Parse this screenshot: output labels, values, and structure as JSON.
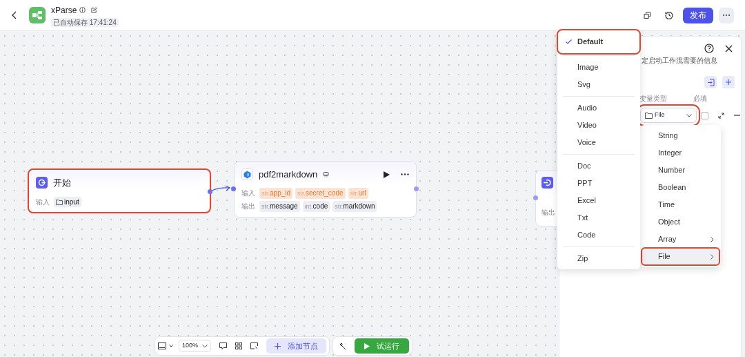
{
  "header": {
    "title": "xParse",
    "saved_badge": "已自动保存 17:41:24",
    "publish_button": "发布"
  },
  "nodes": [
    {
      "kind": "start",
      "title": "开始",
      "highlighted": true,
      "rows": [
        {
          "label": "输入",
          "tags": [
            {
              "kind": "folder",
              "name": "input"
            }
          ]
        }
      ]
    },
    {
      "kind": "plugin",
      "title": "pdf2markdown",
      "highlighted": false,
      "rows": [
        {
          "label": "输入",
          "tags": [
            {
              "kind": "input",
              "type": "str.",
              "name": "app_id"
            },
            {
              "kind": "input",
              "type": "str.",
              "name": "secret_code"
            },
            {
              "kind": "input",
              "type": "str.",
              "name": "url"
            }
          ]
        },
        {
          "label": "输出",
          "tags": [
            {
              "kind": "output",
              "type": "str.",
              "name": "message"
            },
            {
              "kind": "output",
              "type": "int.",
              "name": "code"
            },
            {
              "kind": "output",
              "type": "str.",
              "name": "markdown"
            }
          ]
        }
      ]
    },
    {
      "kind": "end",
      "highlighted": false,
      "rows": [
        {
          "label": "输出",
          "tags": []
        }
      ]
    }
  ],
  "panel": {
    "description": "定启动工作流需要的信息",
    "columns": [
      "变量类型",
      "必填"
    ],
    "variable": {
      "type": "File",
      "required": false,
      "highlighted": true
    }
  },
  "type_menu": [
    {
      "label": "String",
      "submenu": false,
      "selected": false,
      "highlighted": false
    },
    {
      "label": "Integer",
      "submenu": false,
      "selected": false,
      "highlighted": false
    },
    {
      "label": "Number",
      "submenu": false,
      "selected": false,
      "highlighted": false
    },
    {
      "label": "Boolean",
      "submenu": false,
      "selected": false,
      "highlighted": false
    },
    {
      "label": "Time",
      "submenu": false,
      "selected": false,
      "highlighted": false
    },
    {
      "label": "Object",
      "submenu": false,
      "selected": false,
      "highlighted": false
    },
    {
      "label": "Array",
      "submenu": true,
      "selected": false,
      "highlighted": false
    },
    {
      "label": "File",
      "submenu": true,
      "selected": true,
      "highlighted": true
    }
  ],
  "file_menu": [
    [
      {
        "label": "Default",
        "selected": true,
        "highlighted": true
      }
    ],
    [
      {
        "label": "Image",
        "selected": false,
        "highlighted": false
      },
      {
        "label": "Svg",
        "selected": false,
        "highlighted": false
      }
    ],
    [
      {
        "label": "Audio",
        "selected": false,
        "highlighted": false
      },
      {
        "label": "Video",
        "selected": false,
        "highlighted": false
      },
      {
        "label": "Voice",
        "selected": false,
        "highlighted": false
      }
    ],
    [
      {
        "label": "Doc",
        "selected": false,
        "highlighted": false
      },
      {
        "label": "PPT",
        "selected": false,
        "highlighted": false
      },
      {
        "label": "Excel",
        "selected": false,
        "highlighted": false
      },
      {
        "label": "Txt",
        "selected": false,
        "highlighted": false
      },
      {
        "label": "Code",
        "selected": false,
        "highlighted": false
      }
    ],
    [
      {
        "label": "Zip",
        "selected": false,
        "highlighted": false
      }
    ]
  ],
  "toolbar": {
    "zoom": "100%",
    "add_node_button": "添加节点",
    "run_button": "试运行"
  }
}
